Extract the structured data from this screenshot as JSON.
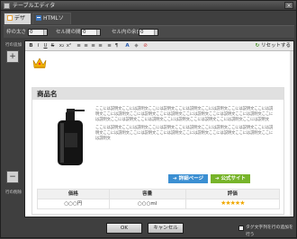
{
  "window": {
    "title": "テーブルエディタ",
    "close_glyph": "×"
  },
  "tabs": [
    {
      "label": "デザイン",
      "icon": "design-icon",
      "active": true
    },
    {
      "label": "HTMLソース",
      "icon": "html-source-icon",
      "active": false
    }
  ],
  "options": {
    "border_width": {
      "label": "枠の太さ",
      "value": "0"
    },
    "cell_spacing": {
      "label": "セル間の間隔",
      "value": "0"
    },
    "cell_padding": {
      "label": "セル内の余白",
      "value": "0"
    }
  },
  "side": {
    "add_row_label": "行の追加",
    "delete_row_label": "行の削除",
    "add_glyph": "+",
    "delete_glyph": "−"
  },
  "toolbar": {
    "items": [
      "B",
      "I",
      "U",
      "S",
      "x₂",
      "x²",
      "≡",
      "≡",
      "≡",
      "≡",
      "≡",
      "¶",
      "A",
      "◆",
      "⊘"
    ],
    "reset_label": "リセットする",
    "reset_icon": "reset-icon"
  },
  "content": {
    "product_title": "商品名",
    "description_paragraphs": [
      "ここには説明文ここには説明文ここには説明文ここには説明文ここには説明文ここには説明文ここには説明文ここには説明文ここには説明文ここには説明文ここには説明文ここには説明文ここには説明文ここには説明文ここには説明文ここには説明文ここには説明文ここには説明文ここには説明文ここには説明文",
      "ここには説明文ここには説明文ここには説明文ここには説明文ここには説明文ここには説明文ここには説明文ここには説明文ここには説明文ここには説明文ここには説明文ここには説明文ここには説明文ここには説明文"
    ],
    "detail_button": "詳細ページ",
    "official_button": "公式サイト",
    "table_headers": [
      "価格",
      "容量",
      "評価"
    ],
    "table_row": [
      "○○○円",
      "○○○ml",
      "★★★★★"
    ],
    "rating_stars": 5
  },
  "footer": {
    "ok_label": "OK",
    "cancel_label": "キャンセル",
    "checkbox_label": "タグ文字列を行の追加を行う",
    "checkbox_checked": false
  },
  "colors": {
    "detail_button": "#3b8fd2",
    "official_button": "#77b42a",
    "stars": "#f0a800",
    "window_bg": "#3f3f3f"
  }
}
